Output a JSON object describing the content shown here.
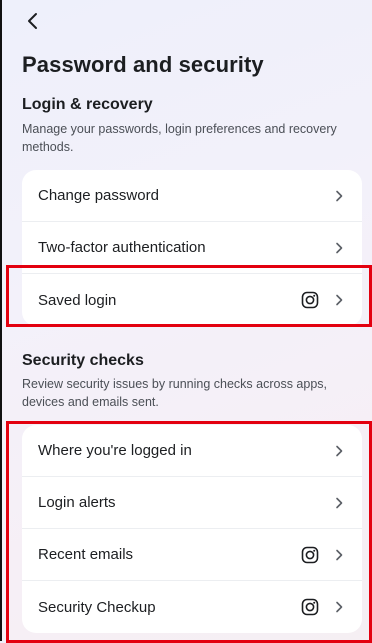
{
  "header": {
    "back_icon": "chevron-left-icon",
    "title": "Password and security"
  },
  "login_recovery": {
    "title": "Login & recovery",
    "description": "Manage your passwords, login preferences and recovery methods.",
    "items": [
      {
        "label": "Change password",
        "icon": null
      },
      {
        "label": "Two-factor authentication",
        "icon": null
      },
      {
        "label": "Saved login",
        "icon": "instagram-icon"
      }
    ]
  },
  "security_checks": {
    "title": "Security checks",
    "description": "Review security issues by running checks across apps, devices and emails sent.",
    "items": [
      {
        "label": "Where you're logged in",
        "icon": null
      },
      {
        "label": "Login alerts",
        "icon": null
      },
      {
        "label": "Recent emails",
        "icon": "instagram-icon"
      },
      {
        "label": "Security Checkup",
        "icon": "instagram-icon"
      }
    ]
  },
  "colors": {
    "highlight": "#e3000f",
    "card_bg": "#ffffff",
    "text_primary": "#1c1e21",
    "text_secondary": "#4b4f56"
  }
}
